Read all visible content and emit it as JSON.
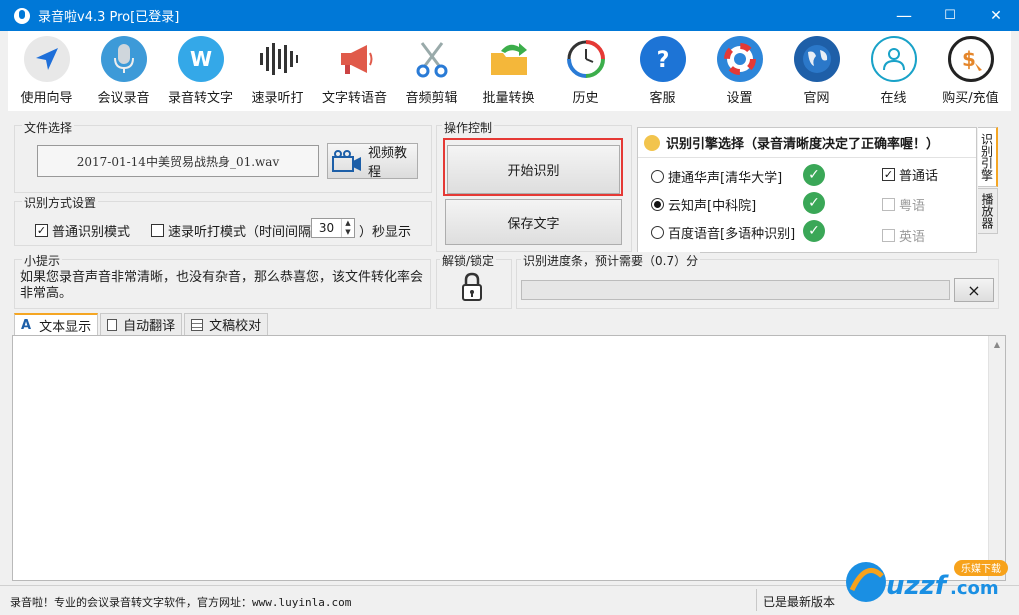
{
  "window": {
    "title": "录音啦v4.3 Pro[已登录]",
    "minimize": "—",
    "maximize": "☐",
    "close": "✕"
  },
  "toolbar": {
    "items": [
      {
        "label": "使用向导",
        "icon": "navigation-arrow-icon"
      },
      {
        "label": "会议录音",
        "icon": "microphone-icon"
      },
      {
        "label": "录音转文字",
        "icon": "w-letter-icon"
      },
      {
        "label": "速录听打",
        "icon": "sound-wave-icon"
      },
      {
        "label": "文字转语音",
        "icon": "megaphone-icon"
      },
      {
        "label": "音频剪辑",
        "icon": "scissors-icon"
      },
      {
        "label": "批量转换",
        "icon": "folder-arrow-icon"
      },
      {
        "label": "历史",
        "icon": "history-clock-icon"
      },
      {
        "label": "客服",
        "icon": "question-icon"
      },
      {
        "label": "设置",
        "icon": "lifebuoy-icon"
      },
      {
        "label": "官网",
        "icon": "globe-icon"
      },
      {
        "label": "在线",
        "icon": "user-online-icon"
      },
      {
        "label": "购买/充值",
        "icon": "dollar-coin-icon"
      }
    ]
  },
  "file_select": {
    "group_title": "文件选择",
    "file_name": "2017-01-14中美贸易战热身_01.wav",
    "video_button": "视频教程"
  },
  "operation": {
    "group_title": "操作控制",
    "start_button": "开始识别",
    "save_button": "保存文字"
  },
  "engine": {
    "title": "识别引擎选择（录音清晰度决定了正确率喔！）",
    "options": [
      {
        "label": "捷通华声[清华大学]",
        "selected": false
      },
      {
        "label": "云知声[中科院]",
        "selected": true
      },
      {
        "label": "百度语音[多语种识别]",
        "selected": false
      }
    ],
    "languages": [
      {
        "label": "普通话",
        "checked": true,
        "enabled": true
      },
      {
        "label": "粤语",
        "checked": false,
        "enabled": false
      },
      {
        "label": "英语",
        "checked": false,
        "enabled": false
      }
    ],
    "side_tab_1": "识别引擎",
    "side_tab_2": "播放器"
  },
  "mode": {
    "group_title": "识别方式设置",
    "normal_mode": "普通识别模式",
    "normal_checked": true,
    "fast_mode": "速录听打模式（时间间隔",
    "fast_checked": false,
    "interval": "30",
    "suffix": "）秒显示"
  },
  "tip": {
    "group_title": "小提示",
    "text": "如果您录音声音非常清晰，也没有杂音，那么恭喜您，该文件转化率会非常高。"
  },
  "lock": {
    "group_title": "解锁/锁定",
    "icon": "padlock-icon"
  },
  "progress": {
    "group_title": "识别进度条，预计需要（0.7）分",
    "value": 0,
    "cancel": "×"
  },
  "tabs": [
    {
      "label": "文本显示",
      "icon": "text-a-icon",
      "active": true
    },
    {
      "label": "自动翻译",
      "icon": "document-icon",
      "active": false
    },
    {
      "label": "文稿校对",
      "icon": "grid-document-icon",
      "active": false
    }
  ],
  "status": {
    "left": "录音啦！专业的会议录音转文字软件，官方网址：www.luyinla.com",
    "right": "已是最新版本"
  },
  "watermark": {
    "text": "uzzf.com",
    "badge": "乐媒下载"
  }
}
